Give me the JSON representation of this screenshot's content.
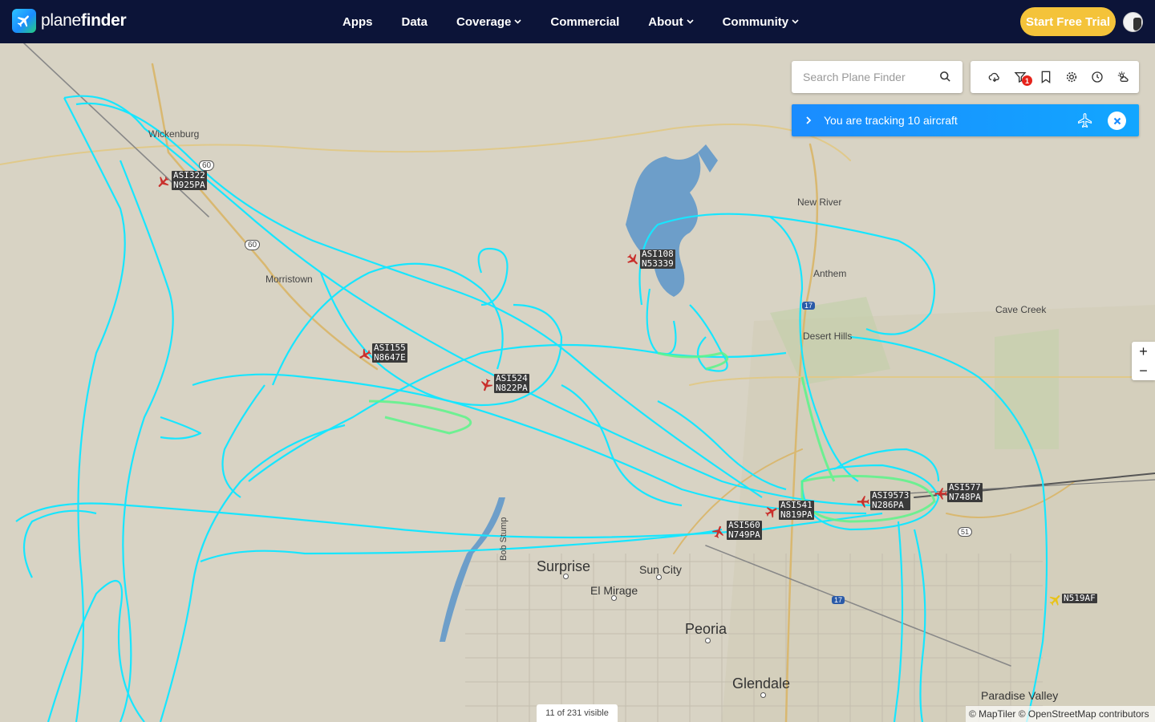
{
  "header": {
    "brand": {
      "part1": "plane",
      "part2": "finder",
      "logo_icon": "plane-logo-icon"
    },
    "nav": [
      {
        "label": "Apps",
        "has_dropdown": false
      },
      {
        "label": "Data",
        "has_dropdown": false
      },
      {
        "label": "Coverage",
        "has_dropdown": true
      },
      {
        "label": "Commercial",
        "has_dropdown": false
      },
      {
        "label": "About",
        "has_dropdown": true
      },
      {
        "label": "Community",
        "has_dropdown": true
      }
    ],
    "cta_label": "Start Free Trial",
    "colors": {
      "navbar": "#0c1438",
      "cta": "#f4c33a"
    }
  },
  "search": {
    "placeholder": "Search Plane Finder",
    "icon": "search-icon"
  },
  "toolbar": {
    "tools": [
      "cloud-icon",
      "filter-icon",
      "bookmark-icon",
      "settings-icon",
      "history-icon",
      "weather-icon"
    ],
    "filter_badge": "1"
  },
  "tracking_bar": {
    "message": "You are tracking 10 aircraft",
    "icons": [
      "chevron-right-icon",
      "plane-outline-icon",
      "close-icon"
    ]
  },
  "zoom": {
    "in": "+",
    "out": "−"
  },
  "status": {
    "visible": "11 of 231 visible"
  },
  "attribution": "© MapTiler © OpenStreetMap contributors",
  "places": {
    "wickenburg": "Wickenburg",
    "morristown": "Morristown",
    "new_river": "New River",
    "anthem": "Anthem",
    "cave_creek": "Cave Creek",
    "desert_hills": "Desert Hills",
    "surprise": "Surprise",
    "sun_city": "Sun City",
    "el_mirage": "El Mirage",
    "peoria": "Peoria",
    "glendale": "Glendale",
    "paradise_valley": "Paradise Valley",
    "bob_stump": "Bob Stump"
  },
  "roads": {
    "us60a": "60",
    "us60b": "60",
    "i17a": "17",
    "i17b": "17",
    "az51": "51"
  },
  "aircraft": [
    {
      "callsign": "ASI322",
      "reg": "N925PA"
    },
    {
      "callsign": "ASI108",
      "reg": "N53339"
    },
    {
      "callsign": "ASI155",
      "reg": "N8647E"
    },
    {
      "callsign": "ASI524",
      "reg": "N822PA"
    },
    {
      "callsign": "ASI541",
      "reg": "N819PA"
    },
    {
      "callsign": "ASI9573",
      "reg": "N286PA"
    },
    {
      "callsign": "ASI577",
      "reg": "N748PA"
    },
    {
      "callsign": "ASI560",
      "reg": "N749PA"
    },
    {
      "callsign": "",
      "reg": "N519AF"
    }
  ],
  "map_colors": {
    "land": "#d8d3c4",
    "track": "#17e6ff",
    "track_alt": "#5cf58a",
    "water": "#6d9ec9",
    "aircraft": "#c9302c",
    "aircraft_alt": "#e8c31a"
  }
}
